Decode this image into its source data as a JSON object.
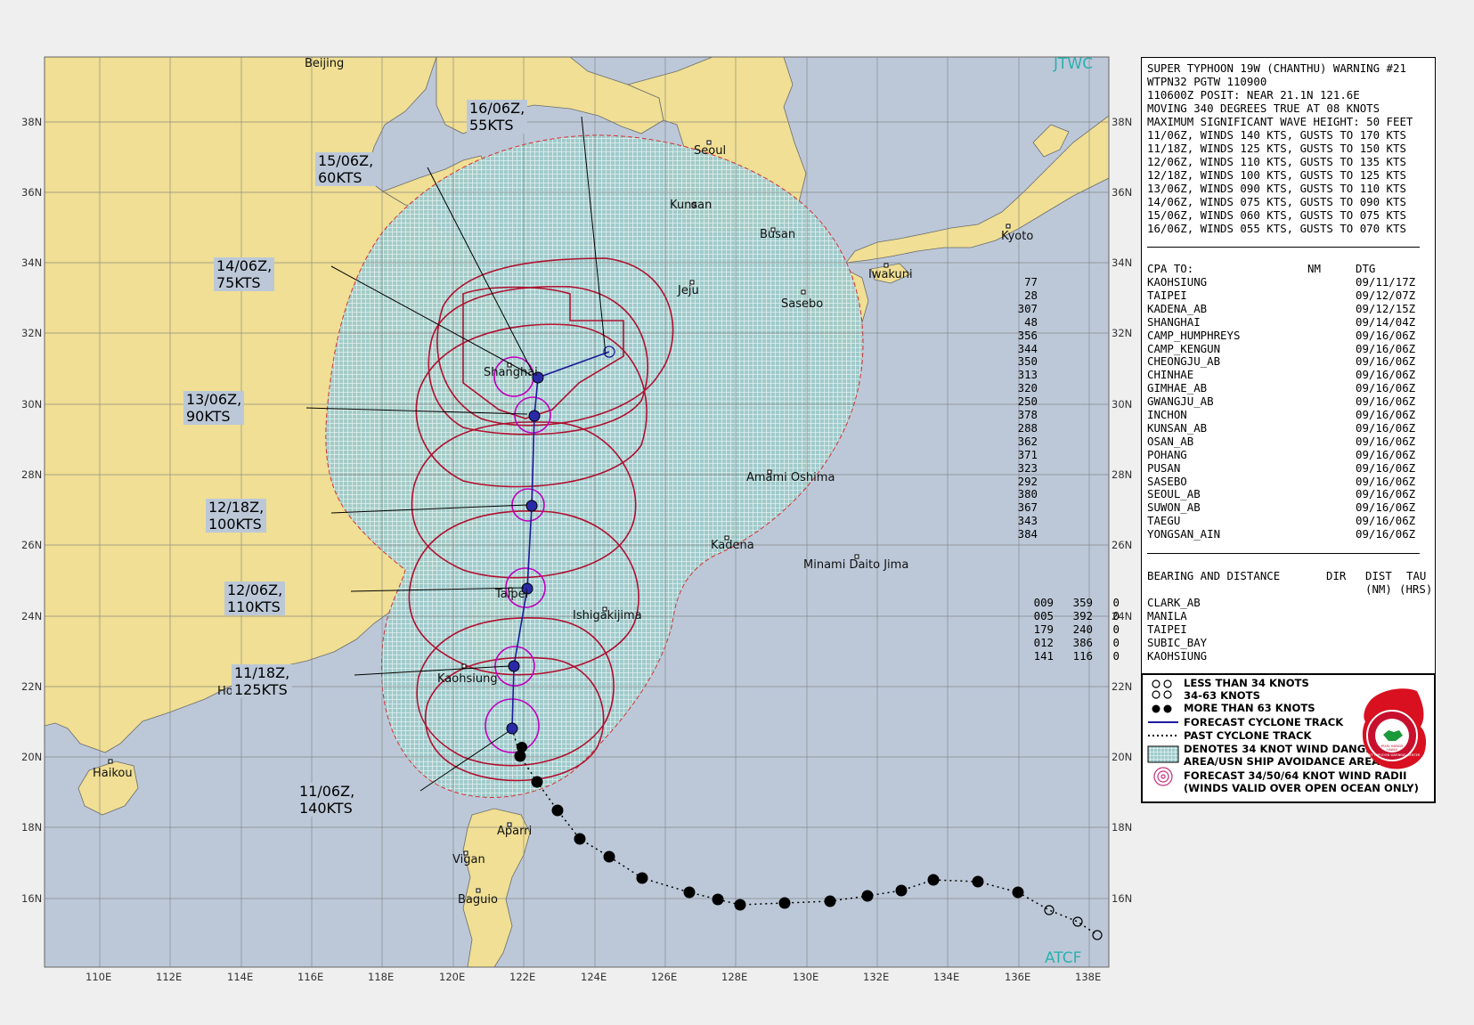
{
  "map": {
    "attribution_top": "JTWC",
    "attribution_bottom": "ATCF",
    "lat_labels": [
      "38N",
      "36N",
      "34N",
      "32N",
      "30N",
      "28N",
      "26N",
      "24N",
      "22N",
      "20N",
      "18N",
      "16N"
    ],
    "lon_labels": [
      "110E",
      "112E",
      "114E",
      "116E",
      "118E",
      "120E",
      "122E",
      "124E",
      "126E",
      "128E",
      "130E",
      "132E",
      "134E",
      "136E",
      "138E"
    ],
    "places": [
      "Beijing",
      "Seoul",
      "Kunsan",
      "Busan",
      "Kyoto",
      "Jeju",
      "Iwakuni",
      "Sasebo",
      "Shanghai",
      "Amami Oshima",
      "Kadena",
      "Minami Daito Jima",
      "Taipei",
      "Ishigakijima",
      "Kaohsiung",
      "Hong Kong",
      "Haikou",
      "Aparri",
      "Vigan",
      "Baguio"
    ],
    "forecast_labels": [
      "16/06Z, 55KTS",
      "15/06Z, 60KTS",
      "14/06Z, 75KTS",
      "13/06Z, 90KTS",
      "12/18Z, 100KTS",
      "12/06Z, 110KTS",
      "11/18Z, 125KTS",
      "11/06Z, 140KTS"
    ],
    "colors": {
      "ocean": "#bcc8d8",
      "land": "#f0df94",
      "danger": "#9ec9c9",
      "radii": "#b01030",
      "radii64": "#c000c0",
      "track": "#1c1c9a"
    }
  },
  "warning": {
    "lines": [
      "SUPER TYPHOON 19W (CHANTHU) WARNING #21",
      "WTPN32 PGTW 110900",
      "110600Z POSIT: NEAR 21.1N 121.6E",
      "MOVING 340 DEGREES TRUE AT 08 KNOTS",
      "MAXIMUM SIGNIFICANT WAVE HEIGHT: 50 FEET",
      "11/06Z, WINDS 140 KTS, GUSTS TO 170 KTS",
      "11/18Z, WINDS 125 KTS, GUSTS TO 150 KTS",
      "12/06Z, WINDS 110 KTS, GUSTS TO 135 KTS",
      "12/18Z, WINDS 100 KTS, GUSTS TO 125 KTS",
      "13/06Z, WINDS 090 KTS, GUSTS TO 110 KTS",
      "14/06Z, WINDS 075 KTS, GUSTS TO 090 KTS",
      "15/06Z, WINDS 060 KTS, GUSTS TO 075 KTS",
      "16/06Z, WINDS 055 KTS, GUSTS TO 070 KTS"
    ]
  },
  "cpa": {
    "headers": [
      "CPA TO:",
      "NM",
      "DTG"
    ],
    "rows": [
      [
        "KAOHSIUNG",
        "77",
        "09/11/17Z"
      ],
      [
        "TAIPEI",
        "28",
        "09/12/07Z"
      ],
      [
        "KADENA_AB",
        "307",
        "09/12/15Z"
      ],
      [
        "SHANGHAI",
        "48",
        "09/14/04Z"
      ],
      [
        "CAMP_HUMPHREYS",
        "356",
        "09/16/06Z"
      ],
      [
        "CAMP_KENGUN",
        "344",
        "09/16/06Z"
      ],
      [
        "CHEONGJU_AB",
        "350",
        "09/16/06Z"
      ],
      [
        "CHINHAE",
        "313",
        "09/16/06Z"
      ],
      [
        "GIMHAE_AB",
        "320",
        "09/16/06Z"
      ],
      [
        "GWANGJU_AB",
        "250",
        "09/16/06Z"
      ],
      [
        "INCHON",
        "378",
        "09/16/06Z"
      ],
      [
        "KUNSAN_AB",
        "288",
        "09/16/06Z"
      ],
      [
        "OSAN_AB",
        "362",
        "09/16/06Z"
      ],
      [
        "POHANG",
        "371",
        "09/16/06Z"
      ],
      [
        "PUSAN",
        "323",
        "09/16/06Z"
      ],
      [
        "SASEBO",
        "292",
        "09/16/06Z"
      ],
      [
        "SEOUL_AB",
        "380",
        "09/16/06Z"
      ],
      [
        "SUWON_AB",
        "367",
        "09/16/06Z"
      ],
      [
        "TAEGU",
        "343",
        "09/16/06Z"
      ],
      [
        "YONGSAN_AIN",
        "384",
        "09/16/06Z"
      ]
    ]
  },
  "bearing": {
    "headers": [
      "BEARING AND DISTANCE",
      "DIR",
      "DIST",
      "TAU"
    ],
    "subheaders": [
      "(NM)",
      "(HRS)"
    ],
    "rows": [
      [
        "CLARK_AB",
        "009",
        "359",
        "0"
      ],
      [
        "MANILA",
        "005",
        "392",
        "0"
      ],
      [
        "TAIPEI",
        "179",
        "240",
        "0"
      ],
      [
        "SUBIC_BAY",
        "012",
        "386",
        "0"
      ],
      [
        "KAOHSIUNG",
        "141",
        "116",
        "0"
      ]
    ]
  },
  "legend": {
    "items": [
      "LESS THAN 34 KNOTS",
      "34-63 KNOTS",
      "MORE THAN 63 KNOTS",
      "FORECAST CYCLONE TRACK",
      "PAST CYCLONE TRACK",
      "DENOTES 34 KNOT WIND DANGER",
      "AREA/USN SHIP AVOIDANCE AREA",
      "FORECAST 34/50/64 KNOT WIND RADII",
      "(WINDS VALID OVER OPEN OCEAN ONLY)"
    ],
    "seal_text": [
      "JOINT TYPHOON WARNING CENTER",
      "PEARL HARBOR",
      "HAWAII"
    ]
  }
}
